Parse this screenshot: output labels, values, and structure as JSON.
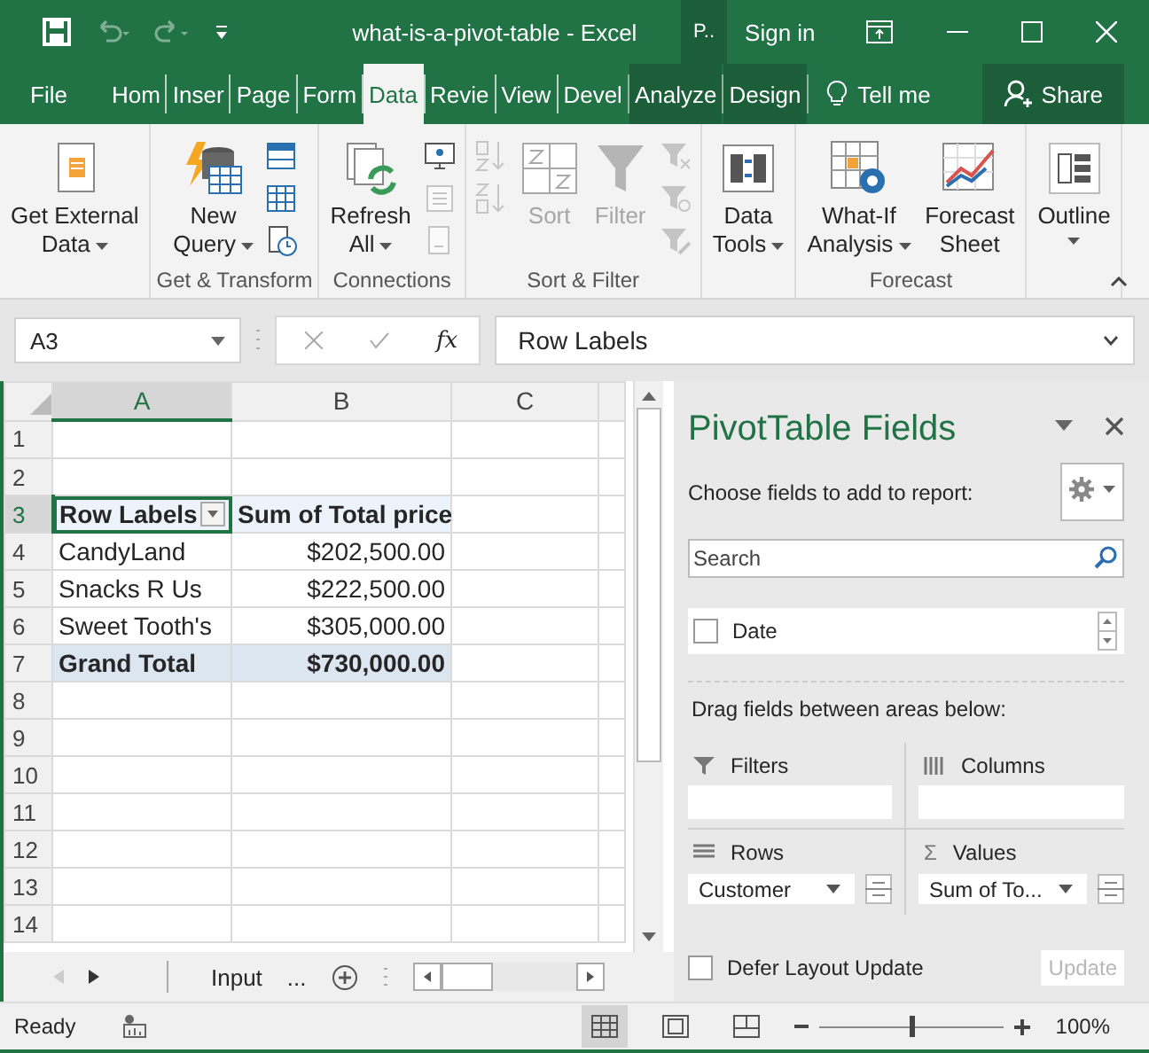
{
  "title_bar": {
    "title": "what-is-a-pivot-table - Excel",
    "context_tab": "P..",
    "sign_in": "Sign in"
  },
  "ribbon_tabs": [
    {
      "label": "File",
      "selected": false,
      "context": false
    },
    {
      "label": "Hom",
      "selected": false,
      "context": false
    },
    {
      "label": "Inser",
      "selected": false,
      "context": false
    },
    {
      "label": "Page",
      "selected": false,
      "context": false
    },
    {
      "label": "Form",
      "selected": false,
      "context": false
    },
    {
      "label": "Data",
      "selected": true,
      "context": false
    },
    {
      "label": "Revie",
      "selected": false,
      "context": false
    },
    {
      "label": "View",
      "selected": false,
      "context": false
    },
    {
      "label": "Devel",
      "selected": false,
      "context": false
    },
    {
      "label": "Analyze",
      "selected": false,
      "context": true
    },
    {
      "label": "Design",
      "selected": false,
      "context": true
    }
  ],
  "tell_me": "Tell me",
  "share": "Share",
  "ribbon_groups": [
    {
      "items": [
        {
          "kind": "large",
          "lines": [
            "Get External",
            "Data"
          ],
          "dropdown": true,
          "disabled": false
        }
      ]
    },
    {
      "label": "Get & Transform",
      "items": [
        {
          "kind": "large",
          "lines": [
            "New",
            "Query"
          ],
          "dropdown": true,
          "disabled": false
        },
        {
          "kind": "stack",
          "buttons": [
            {
              "disabled": false
            },
            {
              "disabled": false
            },
            {
              "disabled": false
            }
          ]
        }
      ]
    },
    {
      "label": "Connections",
      "items": [
        {
          "kind": "large",
          "lines": [
            "Refresh",
            "All"
          ],
          "dropdown": true,
          "disabled": false
        },
        {
          "kind": "stack",
          "buttons": [
            {
              "disabled": false
            },
            {
              "disabled": true
            },
            {
              "disabled": true
            }
          ]
        }
      ]
    },
    {
      "label": "Sort & Filter",
      "items": [
        {
          "kind": "stack",
          "buttons": [
            {
              "disabled": true
            },
            {
              "disabled": true
            }
          ]
        },
        {
          "kind": "large",
          "lines": [
            "Sort"
          ],
          "dropdown": false,
          "disabled": true
        },
        {
          "kind": "large",
          "lines": [
            "Filter"
          ],
          "dropdown": false,
          "disabled": true
        },
        {
          "kind": "stack",
          "buttons": [
            {
              "disabled": true
            },
            {
              "disabled": true
            },
            {
              "disabled": true
            }
          ]
        }
      ]
    },
    {
      "items": [
        {
          "kind": "large",
          "lines": [
            "Data",
            "Tools"
          ],
          "dropdown": true,
          "disabled": false
        }
      ]
    },
    {
      "label": "Forecast",
      "items": [
        {
          "kind": "large",
          "lines": [
            "What-If",
            "Analysis"
          ],
          "dropdown": true,
          "disabled": false
        },
        {
          "kind": "large",
          "lines": [
            "Forecast",
            "Sheet"
          ],
          "dropdown": false,
          "disabled": false
        }
      ]
    },
    {
      "items": [
        {
          "kind": "large",
          "lines": [
            "Outline"
          ],
          "dropdown": true,
          "disabled": false
        }
      ]
    }
  ],
  "formula_bar": {
    "name_box": "A3",
    "function_symbol": "fx",
    "formula": "Row Labels"
  },
  "sheet": {
    "columns": [
      {
        "label": "A",
        "selected": true
      },
      {
        "label": "B",
        "selected": false
      },
      {
        "label": "C",
        "selected": false
      }
    ],
    "rows": [
      {
        "number": "1",
        "kind": "empty",
        "selected": false
      },
      {
        "number": "2",
        "kind": "empty",
        "selected": false
      },
      {
        "number": "3",
        "kind": "header",
        "selected": true,
        "cells": [
          {
            "text": "Row Labels",
            "selected": true
          },
          {
            "text": "Sum of Total price",
            "selected": false
          }
        ]
      },
      {
        "number": "4",
        "kind": "data",
        "selected": false,
        "cells": [
          {
            "text": "CandyLand",
            "selected": false
          },
          {
            "text": "$202,500.00",
            "selected": false
          }
        ]
      },
      {
        "number": "5",
        "kind": "data",
        "selected": false,
        "cells": [
          {
            "text": "Snacks R Us",
            "selected": false
          },
          {
            "text": "$222,500.00",
            "selected": false
          }
        ]
      },
      {
        "number": "6",
        "kind": "data",
        "selected": false,
        "cells": [
          {
            "text": "Sweet Tooth's",
            "selected": false
          },
          {
            "text": "$305,000.00",
            "selected": false
          }
        ]
      },
      {
        "number": "7",
        "kind": "total",
        "selected": false,
        "cells": [
          {
            "text": "Grand Total",
            "selected": false
          },
          {
            "text": "$730,000.00",
            "selected": false
          }
        ]
      },
      {
        "number": "8",
        "kind": "empty",
        "selected": false
      },
      {
        "number": "9",
        "kind": "empty",
        "selected": false
      },
      {
        "number": "10",
        "kind": "empty",
        "selected": false
      },
      {
        "number": "11",
        "kind": "empty",
        "selected": false
      },
      {
        "number": "12",
        "kind": "empty",
        "selected": false
      },
      {
        "number": "13",
        "kind": "empty",
        "selected": false
      },
      {
        "number": "14",
        "kind": "empty",
        "selected": false
      }
    ]
  },
  "sheet_tabs": {
    "tabs": [
      "Input",
      "..."
    ]
  },
  "pivot_pane": {
    "title": "PivotTable Fields",
    "choose_label": "Choose fields to add to report:",
    "search": {
      "placeholder": "Search"
    },
    "fields": [
      {
        "label": "Date",
        "checked": false
      }
    ],
    "drag_label": "Drag fields between areas below:",
    "areas": [
      {
        "kind": "filters",
        "label": "Filters"
      },
      {
        "kind": "columns",
        "label": "Columns"
      },
      {
        "kind": "rows",
        "label": "Rows",
        "item": "Customer"
      },
      {
        "kind": "values",
        "label": "Values",
        "symbol": "Σ",
        "item": "Sum of To..."
      }
    ],
    "defer": {
      "label": "Defer Layout Update",
      "checked": false
    },
    "update_button": {
      "label": "Update",
      "disabled": true
    }
  },
  "status_bar": {
    "status": "Ready",
    "views": [
      {
        "selected": true
      },
      {
        "selected": false
      },
      {
        "selected": false
      }
    ],
    "zoom": {
      "level": 0.5,
      "reading": "100%"
    }
  }
}
